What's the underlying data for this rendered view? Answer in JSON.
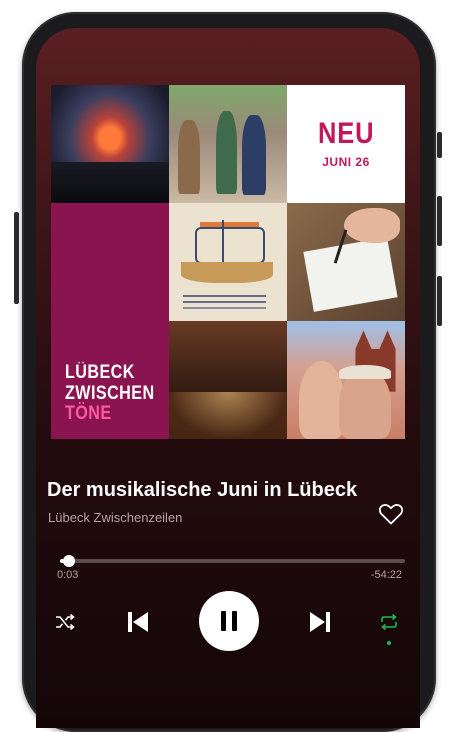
{
  "cover": {
    "neu_title": "NEU",
    "neu_date": "JUNI 26",
    "brand_line1": "LÜBECK",
    "brand_line2": "ZWISCHEN",
    "brand_line3": "TÖNE"
  },
  "track": {
    "title": "Der musikalische Juni in Lübeck",
    "artist": "Lübeck Zwischenzeilen"
  },
  "playback": {
    "elapsed": "0:03",
    "remaining": "-54:22",
    "progress_fraction": 0.025,
    "state": "playing",
    "repeat_active": true
  },
  "icons": {
    "like": "heart-outline-icon",
    "shuffle": "shuffle-icon",
    "previous": "skip-previous-icon",
    "play_pause": "pause-icon",
    "next": "skip-next-icon",
    "repeat": "repeat-icon"
  },
  "colors": {
    "accent_green": "#1db954",
    "brand_magenta": "#8a1450",
    "brand_pink": "#ff5a9e",
    "neu_red": "#c2185b"
  }
}
